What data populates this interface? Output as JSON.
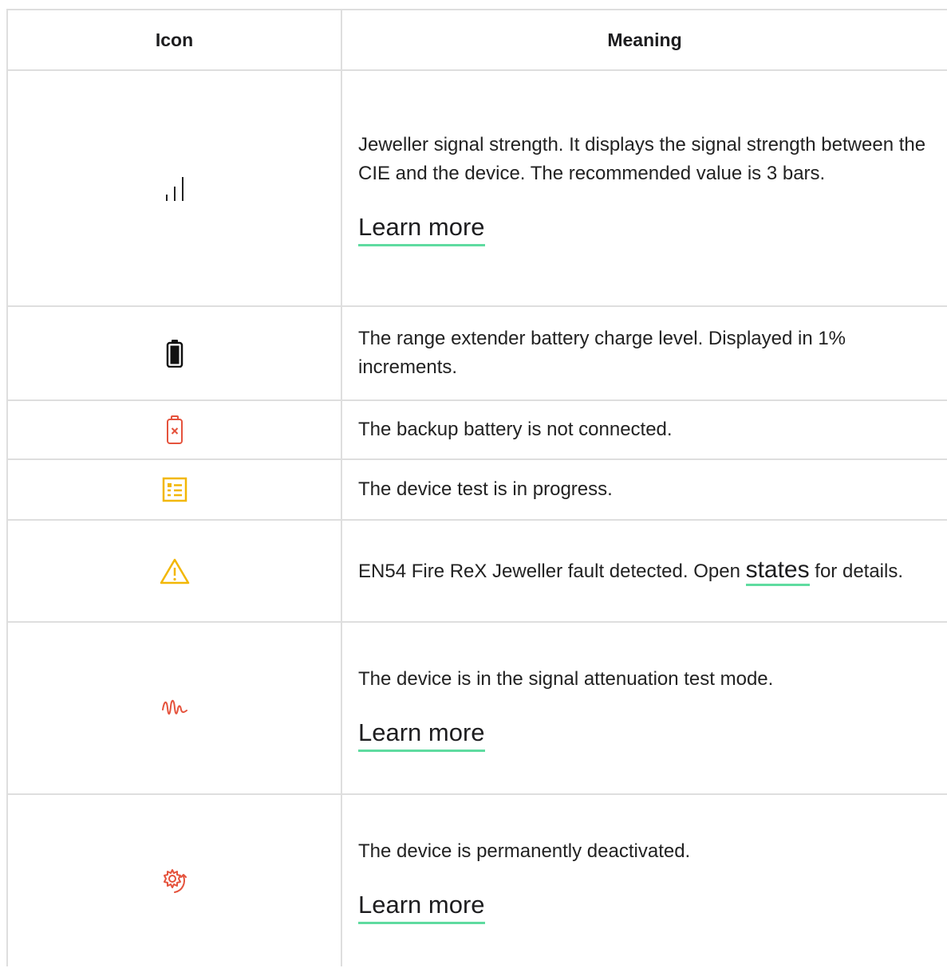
{
  "table": {
    "headers": {
      "icon": "Icon",
      "meaning": "Meaning"
    },
    "rows": [
      {
        "icon": "signal-strength-icon",
        "text": "Jeweller signal strength. It displays the signal strength between the CIE and the device. The recommended value is 3 bars.",
        "link": "Learn more"
      },
      {
        "icon": "battery-icon",
        "text": "The range extender battery charge level. Displayed in 1% increments."
      },
      {
        "icon": "battery-disconnected-icon",
        "text": "The backup battery is not connected."
      },
      {
        "icon": "test-list-icon",
        "text": "The device test is in progress."
      },
      {
        "icon": "warning-icon",
        "text_before": "EN54 Fire ReX Jeweller fault detected. Open ",
        "link": "states",
        "text_after": " for details."
      },
      {
        "icon": "signal-attenuation-icon",
        "text": "The device is in the signal attenuation test mode.",
        "link": "Learn more"
      },
      {
        "icon": "deactivated-gear-icon",
        "text": "The device is permanently deactivated.",
        "link": "Learn more"
      }
    ]
  },
  "colors": {
    "border": "#dedede",
    "link_underline": "#5fdba0",
    "battery_error_red": "#e5533d",
    "test_yellow": "#f2b705",
    "warning_yellow": "#f2b705",
    "attenuation_red": "#e5533d",
    "deactivated_red": "#e5533d"
  }
}
